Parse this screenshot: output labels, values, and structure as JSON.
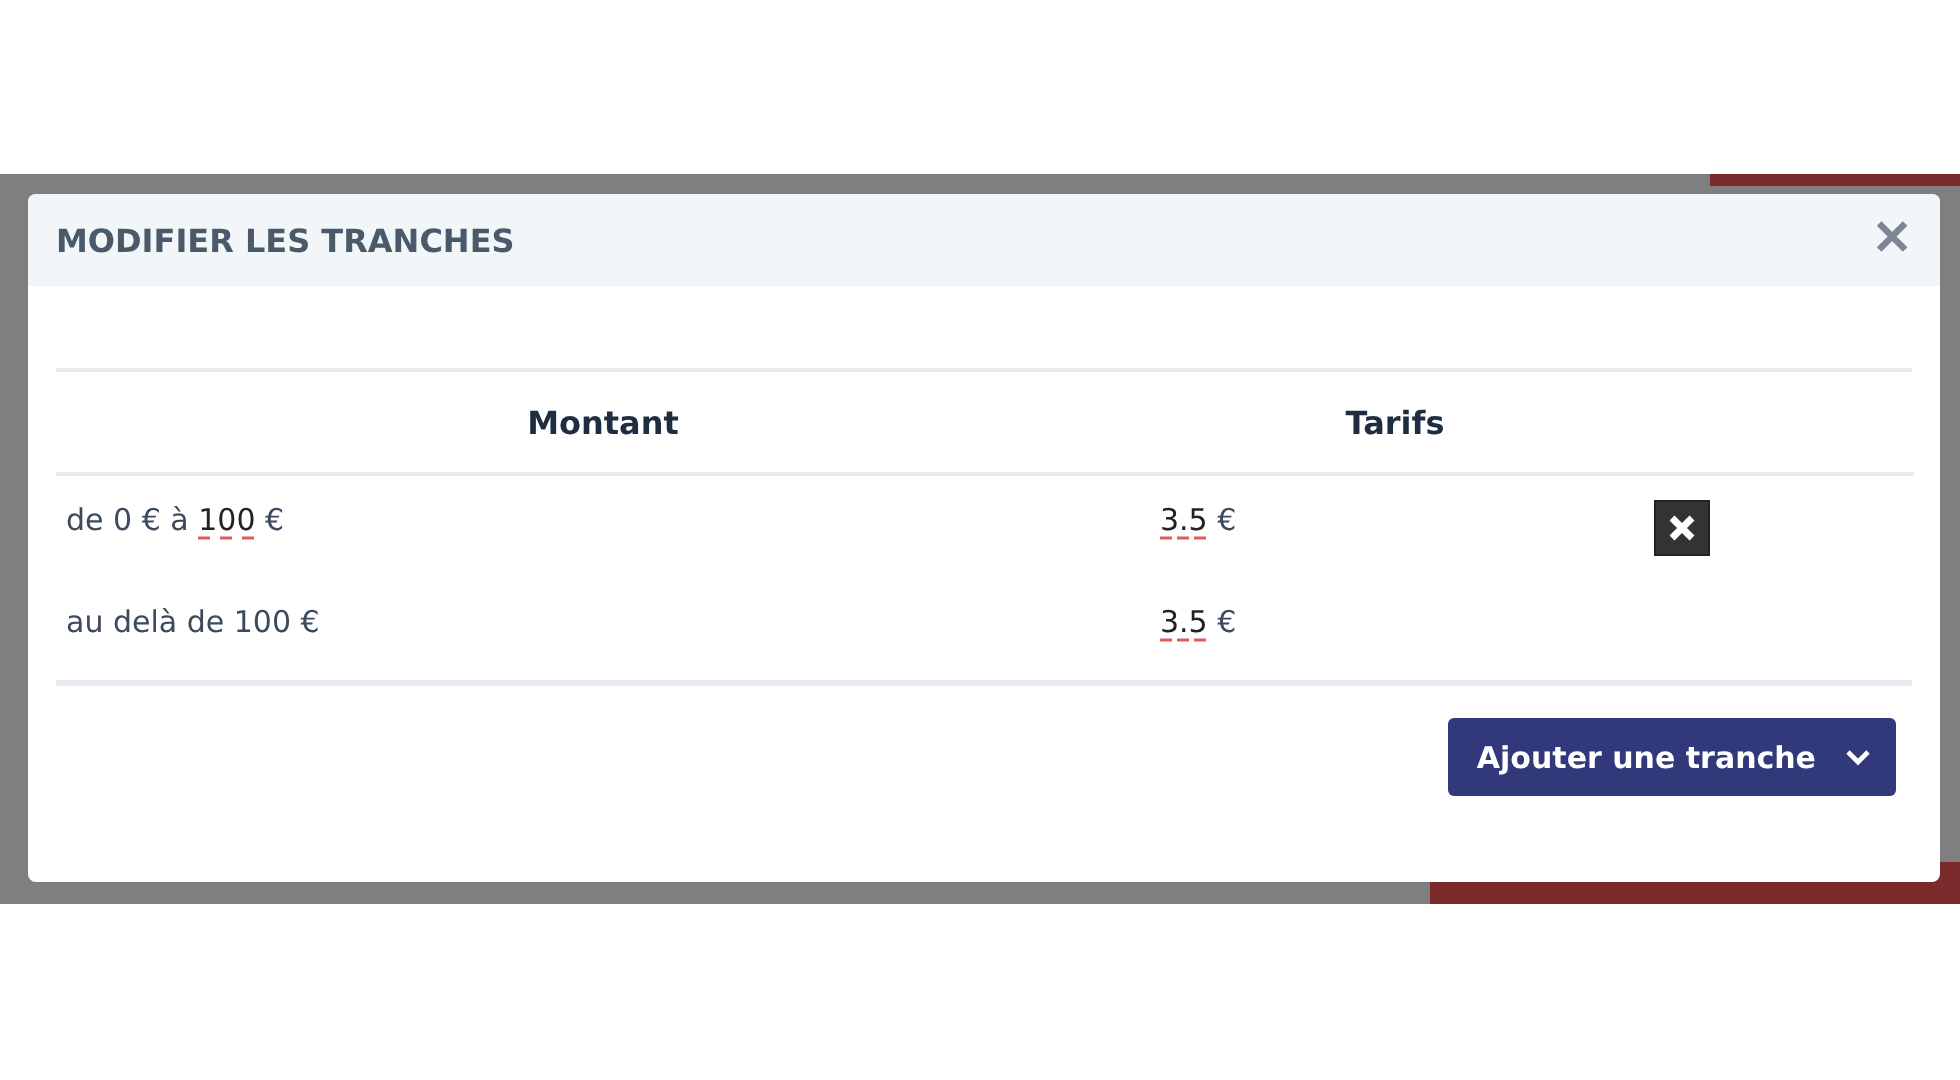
{
  "dialog": {
    "title": "MODIFIER LES TRANCHES",
    "close": "✕"
  },
  "table": {
    "columns": [
      "Montant",
      "Tarifs"
    ],
    "rows": [
      {
        "amount_before": "de 0 € à ",
        "amount_value": "100",
        "amount_after": " €",
        "rate_value": "3.5",
        "rate_unit": " €",
        "deletable": true
      },
      {
        "amount_before": "au delà de 100 €",
        "rate_value": "3.5",
        "rate_unit": " €",
        "deletable": false
      }
    ]
  },
  "add_button": {
    "label": "Ajouter une tranche"
  }
}
